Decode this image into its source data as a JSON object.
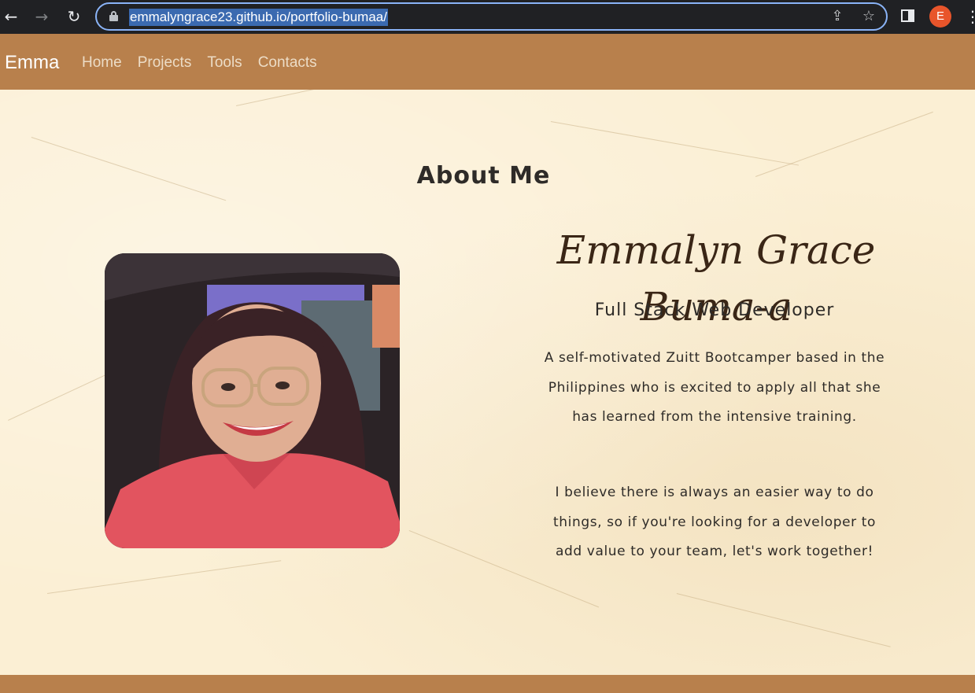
{
  "browser": {
    "url": "emmalyngrace23.github.io/portfolio-bumaa/",
    "profile_initial": "E",
    "icons": [
      "back-arrow-icon",
      "forward-arrow-icon",
      "reload-icon",
      "lock-icon",
      "share-icon",
      "bookmark-star-icon",
      "side-panel-icon",
      "kebab-menu-icon"
    ]
  },
  "navbar": {
    "brand": "Emma",
    "links": [
      "Home",
      "Projects",
      "Tools",
      "Contacts"
    ]
  },
  "about": {
    "title": "About Me",
    "name": "Emmalyn Grace Buma-a",
    "role": "Full Stack Web Developer",
    "paragraph1": "A self-motivated Zuitt Bootcamper based in the Philippines who is excited to apply all that she has learned from the intensive training.",
    "paragraph2": "I believe there is always an easier way to do things, so if you're looking for a developer to add value to your team, let's work together!"
  },
  "colors": {
    "navbar": "#b8804c",
    "page_background": "#fbefd4",
    "name_text": "#3a2616",
    "url_highlight": "#3b6ab0"
  }
}
